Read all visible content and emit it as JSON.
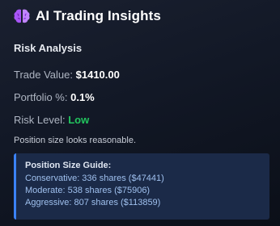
{
  "header": {
    "title": "AI Trading Insights",
    "icon": "brain-icon",
    "icon_color": "#a855f7"
  },
  "risk_analysis": {
    "section_title": "Risk Analysis",
    "trade_value_label": "Trade Value:",
    "trade_value": "$1410.00",
    "portfolio_label": "Portfolio %:",
    "portfolio_value": "0.1%",
    "risk_level_label": "Risk Level:",
    "risk_level_value": "Low",
    "risk_level_color": "#22c55e",
    "note": "Position size looks reasonable."
  },
  "position_guide": {
    "title": "Position Size Guide:",
    "lines": [
      "Conservative: 336 shares ($47441)",
      "Moderate: 538 shares ($75906)",
      "Aggressive: 807 shares ($113859)"
    ],
    "accent_color": "#3b82f6"
  }
}
